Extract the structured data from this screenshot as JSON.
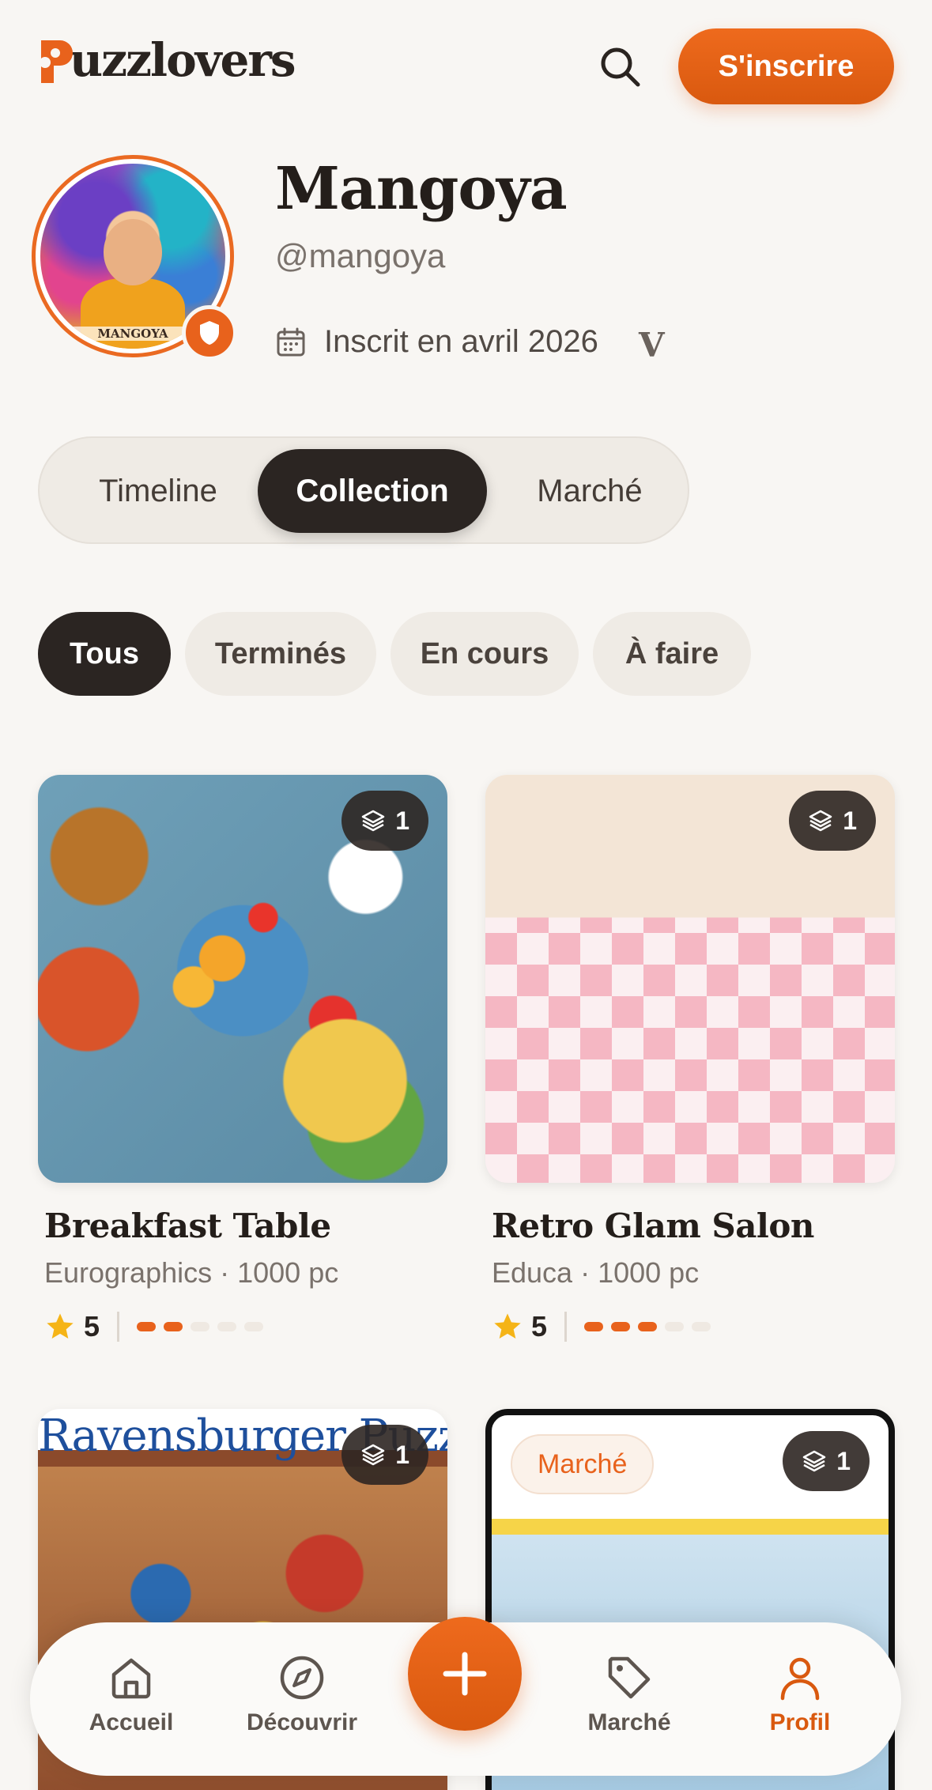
{
  "header": {
    "logo_text": "uzzlovers",
    "logo_initial": "P",
    "signup_label": "S'inscrire"
  },
  "profile": {
    "display_name": "Mangoya",
    "handle": "@mangoya",
    "joined": "Inscrit en avril 2026",
    "level_badge": "V",
    "avatar_caption": "MANGOYA"
  },
  "view_tabs": [
    {
      "label": "Timeline"
    },
    {
      "label": "Collection",
      "active": true
    },
    {
      "label": "Marché"
    }
  ],
  "filters": [
    {
      "label": "Tous",
      "active": true
    },
    {
      "label": "Terminés"
    },
    {
      "label": "En cours"
    },
    {
      "label": "À faire"
    }
  ],
  "cards": [
    {
      "title": "Breakfast Table",
      "meta": "Eurographics · 1000 pc",
      "rating": "5",
      "count": "1",
      "difficulty": 2
    },
    {
      "title": "Retro Glam Salon",
      "meta": "Educa · 1000 pc",
      "rating": "5",
      "count": "1",
      "difficulty": 3
    },
    {
      "brand_text": "Ravensburger Puzzle",
      "count": "1"
    },
    {
      "tag": "Marché",
      "count": "1"
    }
  ],
  "nav": {
    "home": "Accueil",
    "discover": "Découvrir",
    "market": "Marché",
    "profile": "Profil"
  },
  "colors": {
    "accent": "#e8621c",
    "dark": "#2b2522",
    "background": "#f8f6f3"
  }
}
